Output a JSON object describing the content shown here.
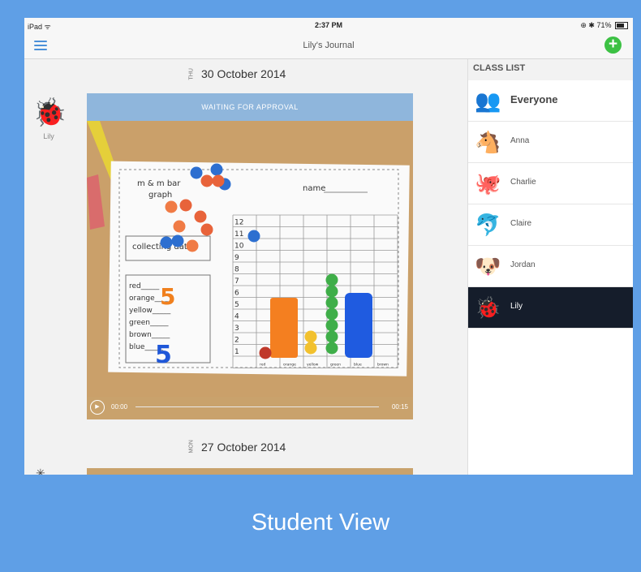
{
  "status": {
    "left": "iPad ᯤ",
    "time": "2:37 PM",
    "right": "⊕ ✱ 71%"
  },
  "nav": {
    "title": "Lily's Journal",
    "add_label": "+"
  },
  "entries": [
    {
      "dow": "THU",
      "date": "30 October 2014",
      "student": "Lily",
      "approval": "WAITING FOR APPROVAL",
      "time_current": "00:00",
      "time_total": "00:15"
    },
    {
      "dow": "MON",
      "date": "27 October 2014"
    }
  ],
  "worksheet": {
    "title_line1": "m & m bar",
    "title_line2": "graph",
    "name_label": "name",
    "section": "collecting data",
    "colors": [
      "red",
      "orange",
      "yellow",
      "green",
      "brown",
      "blue"
    ],
    "tally_orange": "5",
    "tally_blue": "5",
    "y_ticks": [
      "12",
      "11",
      "10",
      "9",
      "8",
      "7",
      "6",
      "5",
      "4",
      "3",
      "2",
      "1"
    ],
    "x_labels": [
      "red",
      "orange",
      "yellow",
      "green",
      "blue",
      "brown"
    ]
  },
  "sidebar": {
    "header": "CLASS LIST",
    "items": [
      {
        "label": "Everyone",
        "icon": "group-icon",
        "glyph": "👥"
      },
      {
        "label": "Anna",
        "icon": "horse-icon",
        "glyph": "🐴"
      },
      {
        "label": "Charlie",
        "icon": "octopus-icon",
        "glyph": "🐙"
      },
      {
        "label": "Claire",
        "icon": "dolphin-icon",
        "glyph": "🐬"
      },
      {
        "label": "Jordan",
        "icon": "dog-icon",
        "glyph": "🐶"
      },
      {
        "label": "Lily",
        "icon": "ladybug-icon",
        "glyph": "🐞"
      }
    ]
  },
  "caption": "Student View",
  "colors": {
    "background": "#5f9fe6",
    "accent": "#4a90d9",
    "add": "#3cc144",
    "selected": "#151d2b",
    "approval": "#8fb6dc"
  }
}
